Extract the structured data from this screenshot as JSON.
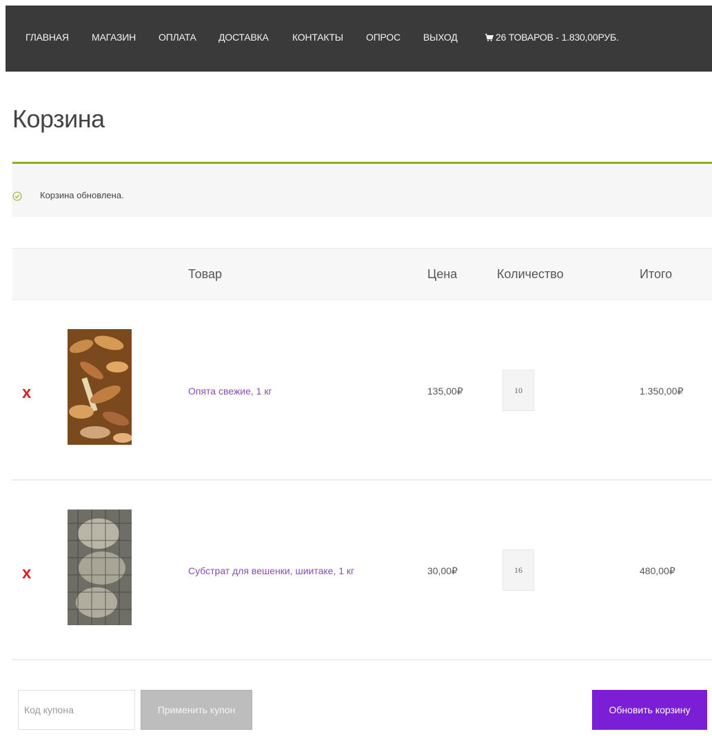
{
  "nav": {
    "items": [
      "ГЛАВНАЯ",
      "МАГАЗИН",
      "ОПЛАТА",
      "ДОСТАВКА",
      "КОНТАКТЫ",
      "ОПРОС",
      "ВЫХОД"
    ],
    "cart_label": "26 ТОВАРОВ - 1.830,00РУБ.",
    "cart_icon": "cart-icon"
  },
  "page": {
    "title": "Корзина"
  },
  "notice": {
    "text": "Корзина обновлена.",
    "icon": "check-circle-icon",
    "accent": "#8fae1b"
  },
  "table": {
    "headers": {
      "product": "Товар",
      "price": "Цена",
      "quantity": "Количество",
      "total": "Итого"
    },
    "rows": [
      {
        "remove": "x",
        "name": "Опята свежие, 1 кг",
        "price": "135,00₽",
        "quantity": "10",
        "total": "1.350,00₽"
      },
      {
        "remove": "x",
        "name": "Субстрат для вешенки, шиитаке, 1 кг",
        "price": "30,00₽",
        "quantity": "16",
        "total": "480,00₽"
      }
    ]
  },
  "actions": {
    "coupon_placeholder": "Код купона",
    "apply_coupon": "Применить купон",
    "update_cart": "Обновить корзину"
  },
  "colors": {
    "nav_bg": "#3a3a3a",
    "link": "#8a4fb0",
    "remove": "#e02020",
    "update_button": "#7a1fd6"
  }
}
